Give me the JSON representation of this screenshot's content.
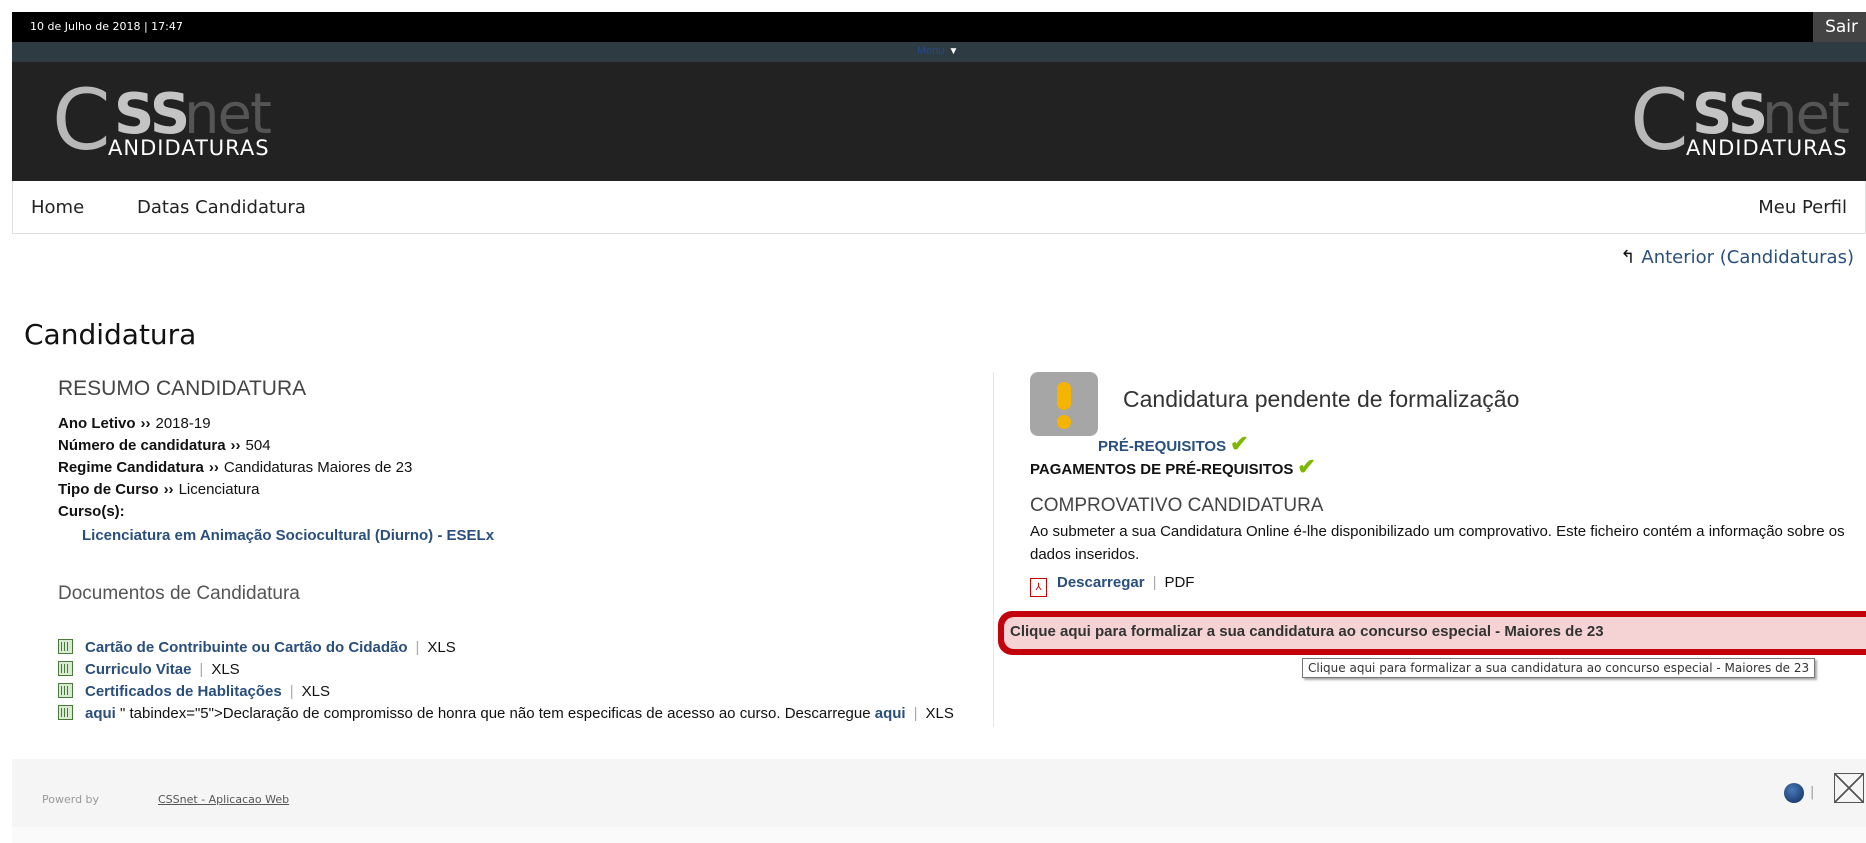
{
  "topbar": {
    "datetime": "10 de Julho de 2018 | 17:47",
    "logout": "Sair"
  },
  "menu_toggle": "Menu",
  "brand": {
    "c": "C",
    "ss": "SS",
    "net": "net",
    "subtitle": "ANDIDATURAS"
  },
  "nav": {
    "home": "Home",
    "datas": "Datas Candidatura",
    "perfil": "Meu Perfil"
  },
  "back_link": "Anterior (Candidaturas)",
  "page_title": "Candidatura",
  "resumo": {
    "title": "RESUMO CANDIDATURA",
    "separator": "››",
    "ano_label": "Ano Letivo",
    "ano_value": "2018-19",
    "numero_label": "Número de candidatura",
    "numero_value": "504",
    "regime_label": "Regime Candidatura",
    "regime_value": "Candidaturas Maiores de 23",
    "tipo_label": "Tipo de Curso",
    "tipo_value": "Licenciatura",
    "cursos_label": "Curso(s):",
    "curso": "Licenciatura em Animação Sociocultural (Diurno) - ESELx"
  },
  "documentos": {
    "title": "Documentos de Candidatura",
    "pipe": "|",
    "items": [
      {
        "name": "Cartão de Contribuinte ou Cartão do Cidadão",
        "type": "XLS"
      },
      {
        "name": "Curriculo Vitae",
        "type": "XLS"
      },
      {
        "name": "Certificados de Hablitações",
        "type": "XLS"
      }
    ],
    "declaracao": {
      "link": "aqui",
      "text": "\" tabindex=\"5\">Declaração de compromisso de honra que não tem especificas de acesso ao curso. Descarregue",
      "link2": "aqui",
      "type": "XLS"
    }
  },
  "status": {
    "title": "Candidatura pendente de formalização",
    "prerequisitos": "PRÉ-REQUISITOS",
    "pagamentos": "PAGAMENTOS DE PRÉ-REQUISITOS",
    "check": "✔"
  },
  "comprovativo": {
    "title": "COMPROVATIVO CANDIDATURA",
    "text": "Ao submeter a sua Candidatura Online é-lhe disponibilizado um comprovativo. Este ficheiro contém a informação sobre os dados inseridos.",
    "download": "Descarregar",
    "pipe": "|",
    "type": "PDF"
  },
  "formalizar": "Clique aqui para formalizar a sua candidatura ao concurso especial - Maiores de 23",
  "tooltip": "Clique aqui para formalizar a sua candidatura ao concurso especial - Maiores de 23",
  "footer": {
    "powered": "Powerd by",
    "link": "CSSnet - Aplicacao Web",
    "divider": "|"
  },
  "colors": {
    "accent": "#2a4f7c",
    "alert": "#c3030c",
    "check": "#7db800",
    "warning": "#f4b400"
  }
}
